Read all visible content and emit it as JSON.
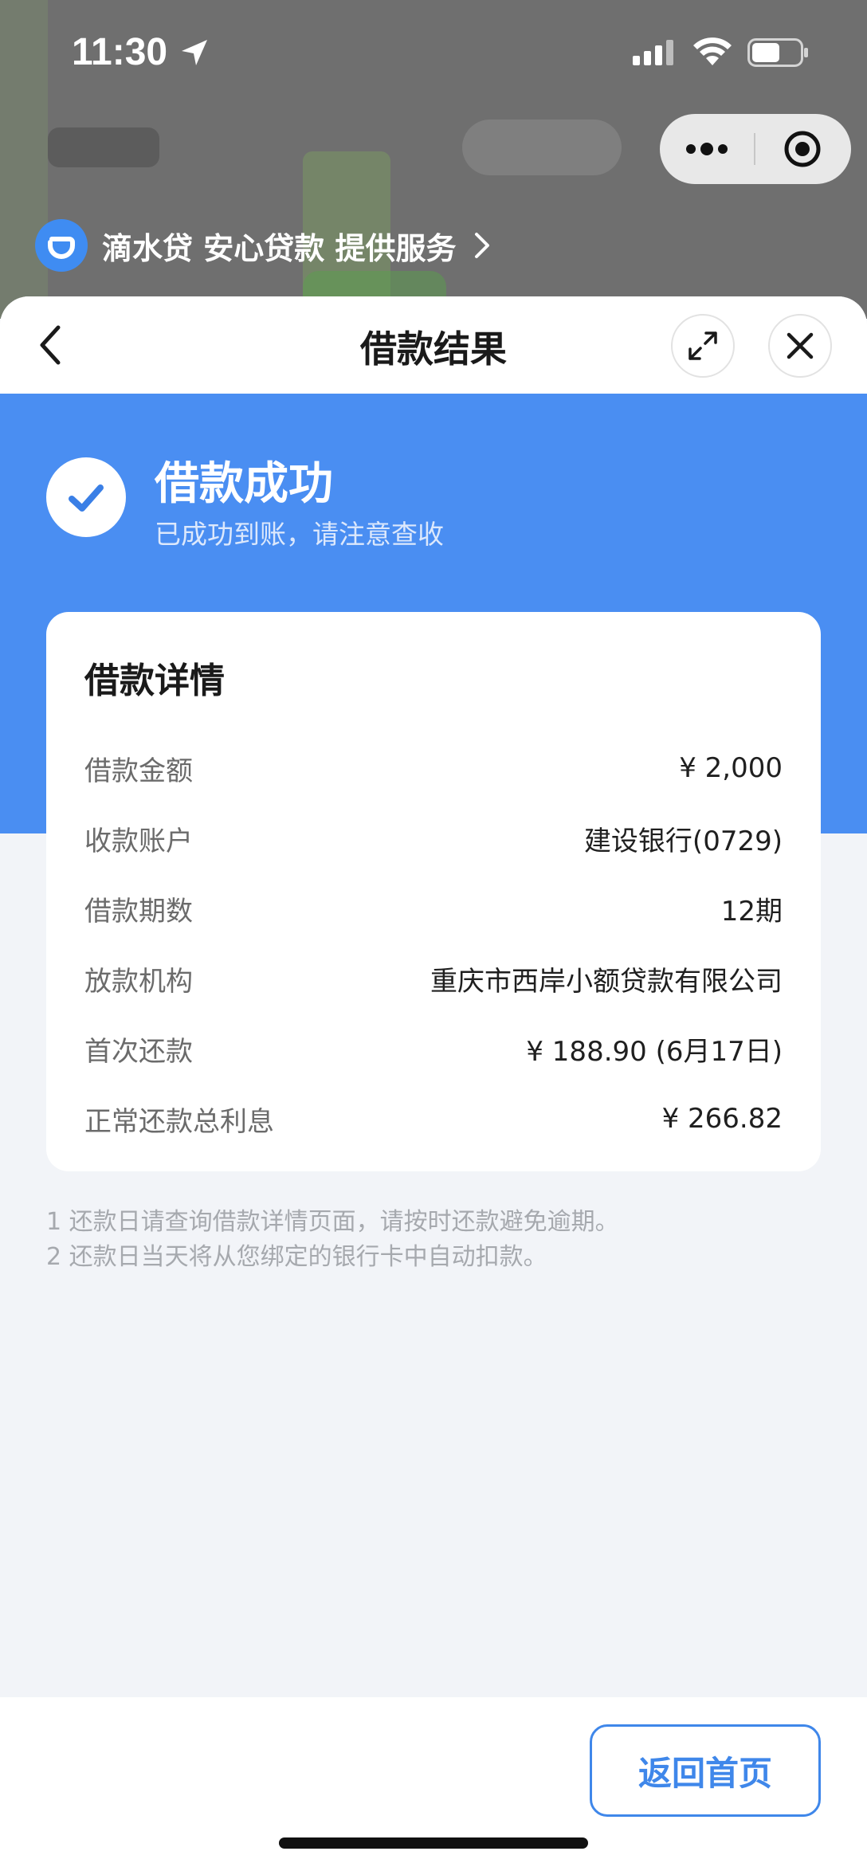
{
  "status_bar": {
    "time": "11:30"
  },
  "provider": {
    "text": "滴水贷 安心贷款 提供服务"
  },
  "sheet": {
    "title": "借款结果"
  },
  "result": {
    "title": "借款成功",
    "subtitle": "已成功到账，请注意查收"
  },
  "details": {
    "title": "借款详情",
    "rows": [
      {
        "label": "借款金额",
        "value": "¥ 2,000"
      },
      {
        "label": "收款账户",
        "value": "建设银行(0729)"
      },
      {
        "label": "借款期数",
        "value": "12期"
      },
      {
        "label": "放款机构",
        "value": "重庆市西岸小额贷款有限公司"
      },
      {
        "label": "首次还款",
        "value": "¥ 188.90 (6月17日)"
      },
      {
        "label": "正常还款总利息",
        "value": "¥ 266.82"
      }
    ]
  },
  "notes": [
    "1 还款日请查询借款详情页面，请按时还款避免逾期。",
    "2 还款日当天将从您绑定的银行卡中自动扣款。"
  ],
  "footer": {
    "home_button": "返回首页"
  },
  "colors": {
    "primary": "#4a8ef2",
    "button_accent": "#3f87ea",
    "background": "#f2f4f8"
  }
}
